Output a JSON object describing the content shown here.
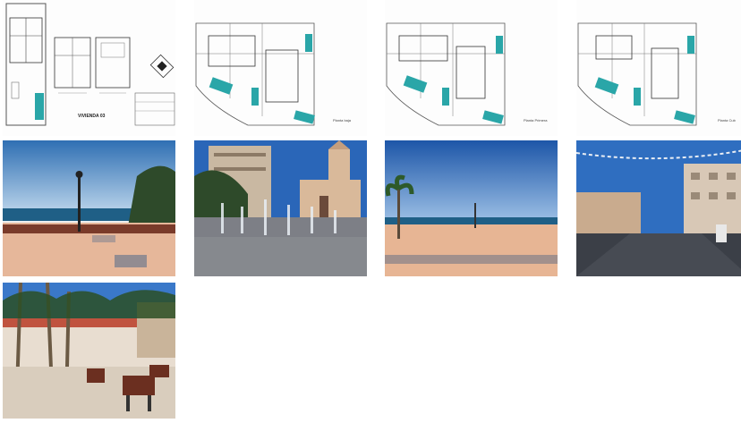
{
  "gallery": {
    "items": [
      {
        "kind": "plan",
        "caption_main": "VIVIENDA 03"
      },
      {
        "kind": "plan",
        "caption_small": "Planta baja"
      },
      {
        "kind": "plan",
        "caption_small": "Planta Primera"
      },
      {
        "kind": "plan",
        "caption_small": "Planta Cub"
      },
      {
        "kind": "photo",
        "scene": "promenade-lamp"
      },
      {
        "kind": "photo",
        "scene": "church-fountain"
      },
      {
        "kind": "photo",
        "scene": "seafront-palm"
      },
      {
        "kind": "photo",
        "scene": "street-lights"
      },
      {
        "kind": "photo",
        "scene": "plaza-benches"
      }
    ]
  },
  "colors": {
    "teal": "#2aa6a8",
    "sky": "#3f7fc4",
    "sea": "#1f5f86",
    "paving": "#e4b99a"
  }
}
